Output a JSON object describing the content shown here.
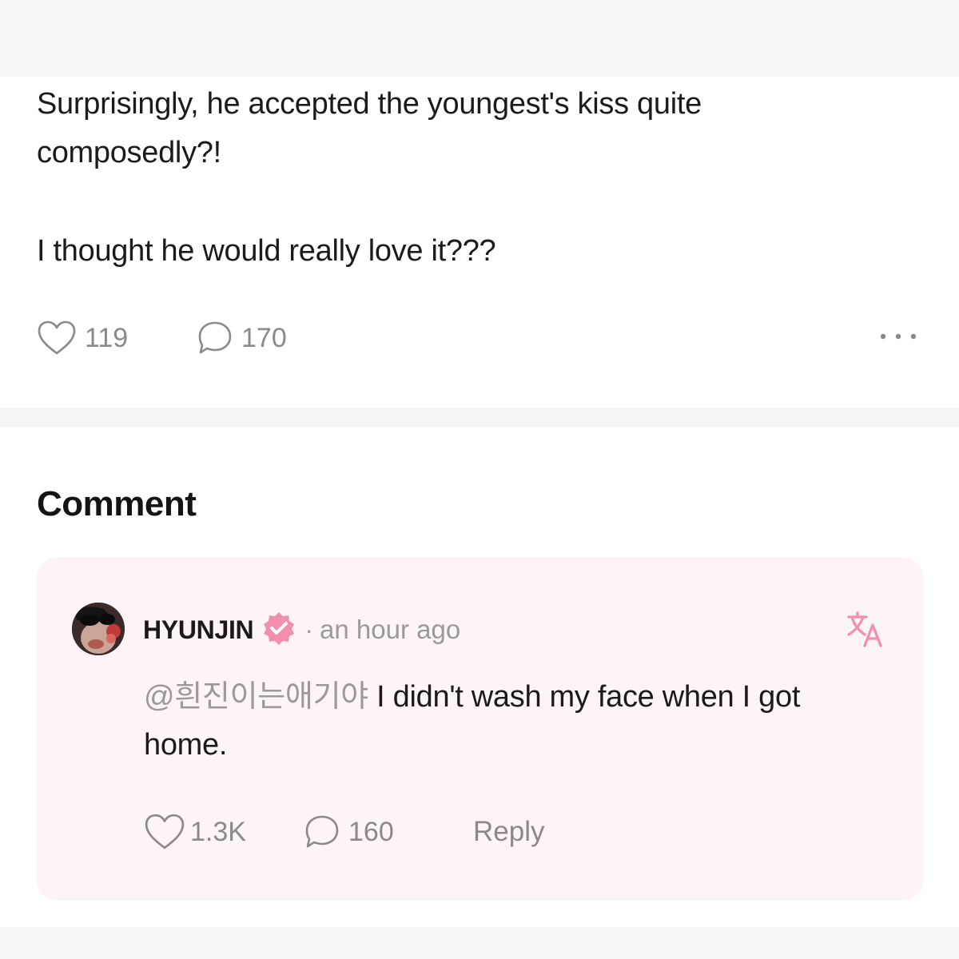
{
  "post": {
    "lines": [
      "Surprisingly, he accepted the youngest's kiss quite composedly?!",
      "I thought he would really love it???"
    ],
    "likes": "119",
    "comments": "170"
  },
  "comment_section": {
    "heading": "Comment"
  },
  "comment": {
    "author": "HYUNJIN",
    "separator": "·",
    "time": "an hour ago",
    "mention": "@흰진이는애기야",
    "text": " I didn't wash my face when I got home.",
    "likes": "1.3K",
    "replies": "160",
    "reply_label": "Reply"
  },
  "colors": {
    "accent_pink": "#f28fad",
    "muted_text": "#8a8a8a",
    "card_background": "#fdf4f7"
  },
  "icons": [
    "heart-icon",
    "comment-bubble-icon",
    "more-icon",
    "verified-badge-icon",
    "translate-icon"
  ]
}
